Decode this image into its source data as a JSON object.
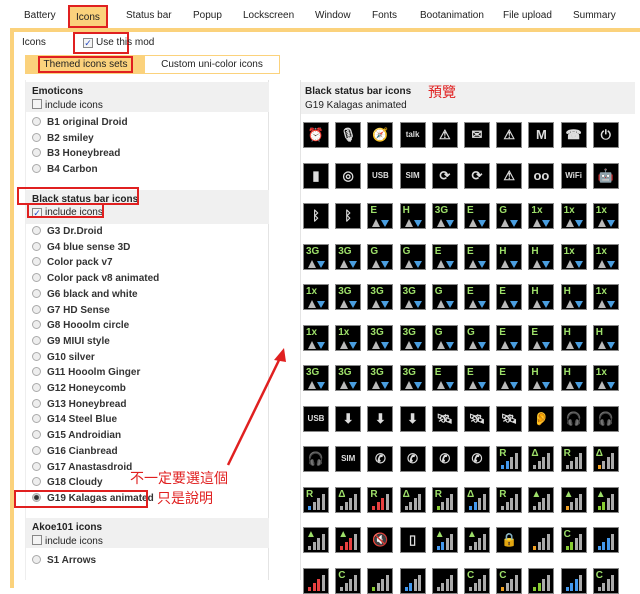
{
  "tabs": [
    "Battery",
    "Icons",
    "Status bar",
    "Popup",
    "Lockscreen",
    "Window",
    "Fonts",
    "Bootanimation",
    "File upload",
    "Summary"
  ],
  "icons_label": "Icons",
  "use_mod_label": "Use this mod",
  "subtabs": [
    "Themed icons sets",
    "Custom uni-color icons"
  ],
  "include_label": "include icons",
  "sections": [
    {
      "title": "Emoticons",
      "include": false,
      "items": [
        "B1 original Droid",
        "B2 smiley",
        "B3 Honeybread",
        "B4 Carbon"
      ]
    },
    {
      "title": "Black status bar icons",
      "include": true,
      "items": [
        "G3 Dr.Droid",
        "G4 blue sense 3D",
        "Color pack v7",
        "Color pack v8 animated",
        "G6 black and white",
        "G7 HD Sense",
        "G8 Hooolm circle",
        "G9 MIUI style",
        "G10 silver",
        "G11 Hooolm Ginger",
        "G12 Honeycomb",
        "G13 Honeybread",
        "G14 Steel Blue",
        "G15 Androidian",
        "G16 Cianbread",
        "G17 Anastasdroid",
        "G18 Cloudy",
        "G19 Kalagas animated"
      ]
    },
    {
      "title": "Akoe101 icons",
      "include": false,
      "items": [
        "S1 Arrows"
      ]
    }
  ],
  "selected": "G19 Kalagas animated",
  "preview": {
    "title": "Black status bar icons",
    "subtitle": "G19 Kalagas animated"
  },
  "annotations": {
    "preview": "預覽",
    "note1": "不一定要選這個",
    "note2": "只是說明"
  },
  "icon_rows": [
    [
      "⏰",
      "🎙",
      "🧭",
      "talk",
      "⚠",
      "✉",
      "⚠",
      "M",
      "☎",
      "⏻"
    ],
    [
      "▮",
      "◎",
      "USB",
      "SIM",
      "⟳",
      "⟳",
      "⚠",
      "oo",
      "WiFi",
      "🤖"
    ],
    [
      "ᛒ",
      "ᛒ",
      "E",
      "H",
      "3G",
      "E",
      "G",
      "1x",
      "1x",
      "1x"
    ],
    [
      "3G",
      "3G",
      "G",
      "G",
      "E",
      "E",
      "H",
      "H",
      "1x",
      "1x"
    ],
    [
      "1x",
      "3G",
      "3G",
      "3G",
      "G",
      "E",
      "E",
      "H",
      "H",
      "1x"
    ],
    [
      "1x",
      "1x",
      "3G",
      "3G",
      "G",
      "G",
      "E",
      "E",
      "H",
      "H"
    ],
    [
      "3G",
      "3G",
      "3G",
      "3G",
      "E",
      "E",
      "E",
      "H",
      "H",
      "1x"
    ],
    [
      "USB",
      "⬇",
      "⬇",
      "⬇",
      "🛰",
      "🛰",
      "🛰",
      "👂",
      "🎧",
      "🎧"
    ],
    [
      "🎧",
      "SIM",
      "✆",
      "✆",
      "✆",
      "✆",
      "R",
      "Δ",
      "R",
      "Δ"
    ],
    [
      "R",
      "Δ",
      "R",
      "Δ",
      "R",
      "Δ",
      "R",
      "▲",
      "▲",
      "▲"
    ],
    [
      "▲",
      "▲",
      "🔇",
      "▯",
      "▲",
      "▲",
      "🔒",
      "",
      "C",
      ""
    ],
    [
      "",
      "C",
      "",
      "",
      "",
      "C",
      "C",
      "",
      "",
      "C"
    ]
  ],
  "colors": {
    "accent": "#fbd27c",
    "annotation": "#e02020"
  }
}
